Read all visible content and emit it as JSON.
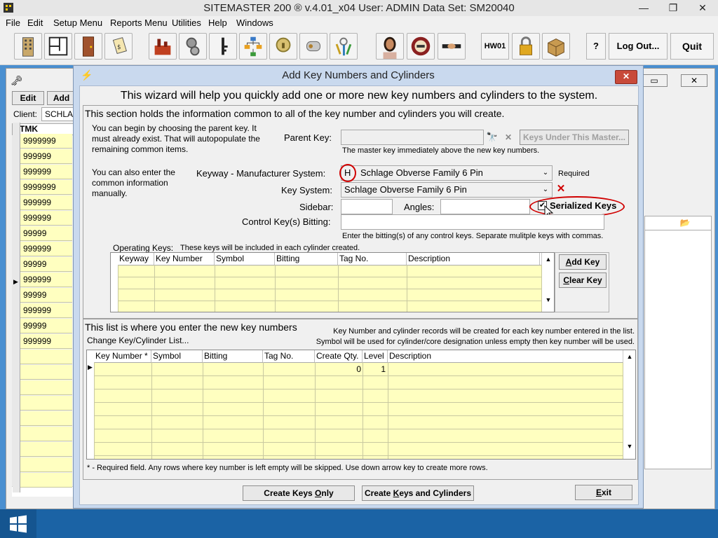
{
  "window": {
    "title": "SITEMASTER 200 ® v.4.01_x04   User: ADMIN   Data Set: SM20040",
    "min": "—",
    "max": "❐",
    "close": "✕"
  },
  "menu": [
    "File",
    "Edit",
    "Setup Menu",
    "Reports Menu",
    "Utilities",
    "Help",
    "Windows"
  ],
  "toolbar": {
    "hw01": "HW01",
    "logout": "Log Out...",
    "quit": "Quit",
    "help": "?"
  },
  "background": {
    "edit_btn": "Edit",
    "add_btn": "Add",
    "client_label": "Client:",
    "client_value": "SCHLA",
    "column": "TMK",
    "rows": [
      "9999999",
      "999999",
      "999999",
      "9999999",
      "999999",
      "999999",
      "99999",
      "999999",
      "99999",
      "999999",
      "99999",
      "999999",
      "99999",
      "999999"
    ]
  },
  "dialog": {
    "title": "Add Key Numbers and Cylinders",
    "close": "✕",
    "heading": "This wizard will help you quickly add one or more new key numbers and cylinders to the system.",
    "section1": {
      "title": "This section holds the information common to all of the key number and cylinders you will create.",
      "intro1": "You can begin by choosing the parent key.  It must already exist.  That will autopopulate the remaining common items.",
      "intro2": "You can also enter the common information manually.",
      "parent_key_label": "Parent Key:",
      "parent_key_value": "",
      "keys_under_master": "Keys Under This Master...",
      "parent_hint": "The master key immediately above the new key numbers.",
      "keyway_label": "Keyway - Manufacturer System:",
      "keyway_code": "H",
      "keyway_value": "Schlage Obverse Family 6 Pin",
      "required": "Required",
      "key_system_label": "Key System:",
      "key_system_value": "Schlage Obverse Family 6 Pin",
      "sidebar_label": "Sidebar:",
      "angles_label": "Angles:",
      "serialized_label": "Serialized Keys",
      "serialized_checked": true,
      "control_label": "Control Key(s) Bitting:",
      "control_hint": "Enter the bitting(s) of any control keys.  Separate mulitple keys with commas.",
      "operating_keys_label": "Operating Keys:",
      "operating_keys_hint": "These keys will be included in each cylinder created.",
      "op_columns": [
        "Keyway",
        "Key Number",
        "Symbol",
        "Bitting",
        "Tag No.",
        "Description"
      ],
      "add_key": "Add Key",
      "clear_key": "Clear Key"
    },
    "section2": {
      "title": "This list is where you enter the new key numbers",
      "change_link": "Change Key/Cylinder List...",
      "note1": "Key Number and cylinder records will be created for each key number entered in the list.",
      "note2": "Symbol will be used for cylinder/core designation unless empty then key number will be used.",
      "columns": [
        "Key Number *",
        "Symbol",
        "Bitting",
        "Tag No.",
        "Create Qty.",
        "Level",
        "Description"
      ],
      "first_row": {
        "qty": "0",
        "level": "1"
      }
    },
    "footer_note": "* - Required field.  Any rows where key number is left empty will be skipped.  Use down arrow key to create more rows.",
    "create_keys_only": "Create Keys Only",
    "create_keys_cyl": "Create Keys and Cylinders",
    "exit": "Exit"
  },
  "colors": {
    "grid_bg": "#ffffc0",
    "highlight": "#d00000",
    "dialog_frame": "#c9d9ee",
    "taskbar": "#1b63a5"
  }
}
